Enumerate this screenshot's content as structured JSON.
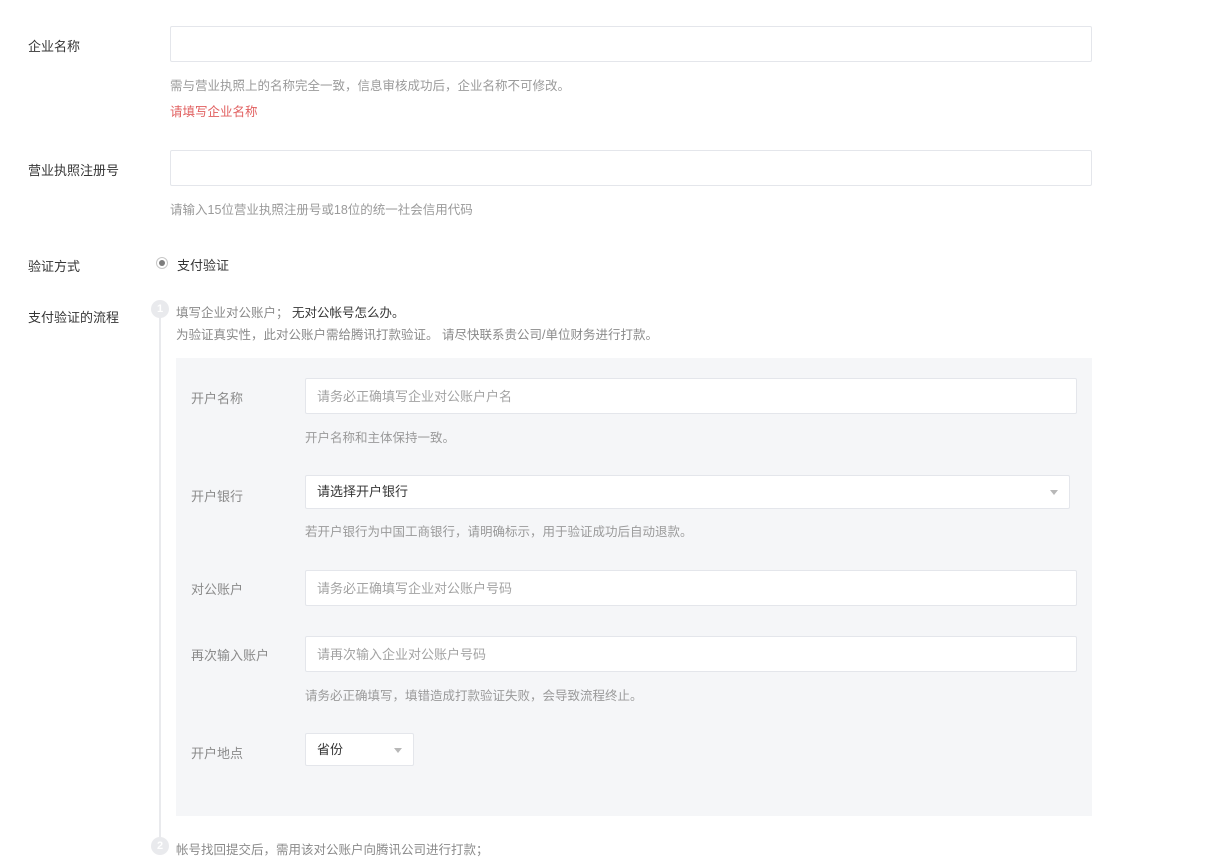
{
  "company_name": {
    "label": "企业名称",
    "value": "",
    "hint": "需与营业执照上的名称完全一致，信息审核成功后，企业名称不可修改。",
    "error": "请填写企业名称"
  },
  "license_number": {
    "label": "营业执照注册号",
    "value": "",
    "hint": "请输入15位营业执照注册号或18位的统一社会信用代码"
  },
  "verification_method": {
    "label": "验证方式",
    "options": [
      {
        "label": "支付验证",
        "selected": true
      }
    ]
  },
  "payment_flow": {
    "label": "支付验证的流程",
    "step1": {
      "number": "1",
      "title": "填写企业对公账户；",
      "link": "无对公帐号怎么办。",
      "description": "为验证真实性，此对公账户需给腾讯打款验证。 请尽快联系贵公司/单位财务进行打款。"
    },
    "form": {
      "account_name": {
        "label": "开户名称",
        "placeholder": "请务必正确填写企业对公账户户名",
        "hint": "开户名称和主体保持一致。"
      },
      "bank": {
        "label": "开户银行",
        "selected": "请选择开户银行",
        "hint": "若开户银行为中国工商银行，请明确标示，用于验证成功后自动退款。"
      },
      "account_number": {
        "label": "对公账户",
        "placeholder": "请务必正确填写企业对公账户号码"
      },
      "account_number_confirm": {
        "label": "再次输入账户",
        "placeholder": "请再次输入企业对公账户号码",
        "hint": "请务必正确填写，填错造成打款验证失败，会导致流程终止。"
      },
      "location": {
        "label": "开户地点",
        "selected": "省份"
      }
    },
    "step2": {
      "number": "2",
      "text": "帐号找回提交后，需用该对公账户向腾讯公司进行打款；"
    }
  }
}
